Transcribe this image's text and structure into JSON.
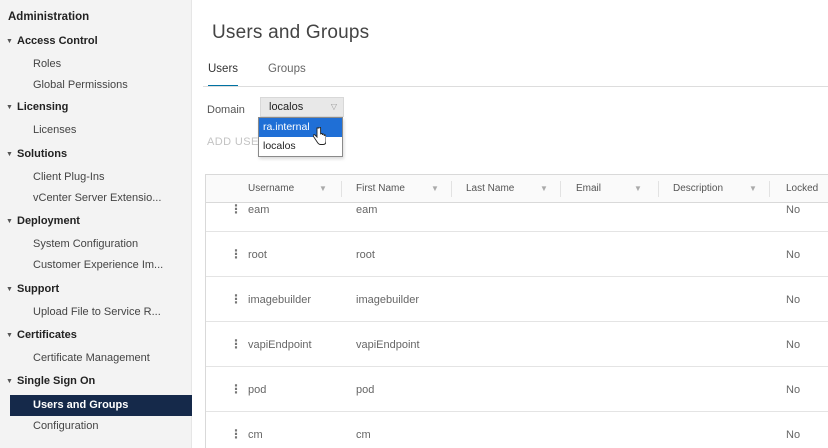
{
  "sidebar": {
    "title": "Administration",
    "sections": [
      {
        "label": "Access Control",
        "items": [
          "Roles",
          "Global Permissions"
        ]
      },
      {
        "label": "Licensing",
        "items": [
          "Licenses"
        ]
      },
      {
        "label": "Solutions",
        "items": [
          "Client Plug-Ins",
          "vCenter Server Extensio..."
        ]
      },
      {
        "label": "Deployment",
        "items": [
          "System Configuration",
          "Customer Experience Im..."
        ]
      },
      {
        "label": "Support",
        "items": [
          "Upload File to Service R..."
        ]
      },
      {
        "label": "Certificates",
        "items": [
          "Certificate Management"
        ]
      },
      {
        "label": "Single Sign On",
        "items": [
          "Users and Groups",
          "Configuration"
        ]
      }
    ],
    "active_item": "Users and Groups"
  },
  "main": {
    "title": "Users and Groups",
    "tabs": [
      {
        "label": "Users",
        "active": true
      },
      {
        "label": "Groups",
        "active": false
      }
    ],
    "domain_label": "Domain",
    "domain_value": "localos",
    "domain_options": [
      "ra.internal",
      "localos"
    ],
    "domain_highlighted": "ra.internal",
    "add_user_label": "ADD USE"
  },
  "table": {
    "columns": [
      "Username",
      "First Name",
      "Last Name",
      "Email",
      "Description",
      "Locked"
    ],
    "rows": [
      {
        "username": "eam",
        "first_name": "eam",
        "last_name": "",
        "email": "",
        "description": "",
        "locked": "No"
      },
      {
        "username": "root",
        "first_name": "root",
        "last_name": "",
        "email": "",
        "description": "",
        "locked": "No"
      },
      {
        "username": "imagebuilder",
        "first_name": "imagebuilder",
        "last_name": "",
        "email": "",
        "description": "",
        "locked": "No"
      },
      {
        "username": "vapiEndpoint",
        "first_name": "vapiEndpoint",
        "last_name": "",
        "email": "",
        "description": "",
        "locked": "No"
      },
      {
        "username": "pod",
        "first_name": "pod",
        "last_name": "",
        "email": "",
        "description": "",
        "locked": "No"
      },
      {
        "username": "cm",
        "first_name": "cm",
        "last_name": "",
        "email": "",
        "description": "",
        "locked": "No"
      }
    ],
    "row_actions_icon": "vertical-ellipsis-icon",
    "filter_icon": "filter-icon"
  },
  "colors": {
    "active_nav_bg": "#15294a",
    "highlight": "#1f6fd6",
    "tab_underline": "#0072a3"
  }
}
